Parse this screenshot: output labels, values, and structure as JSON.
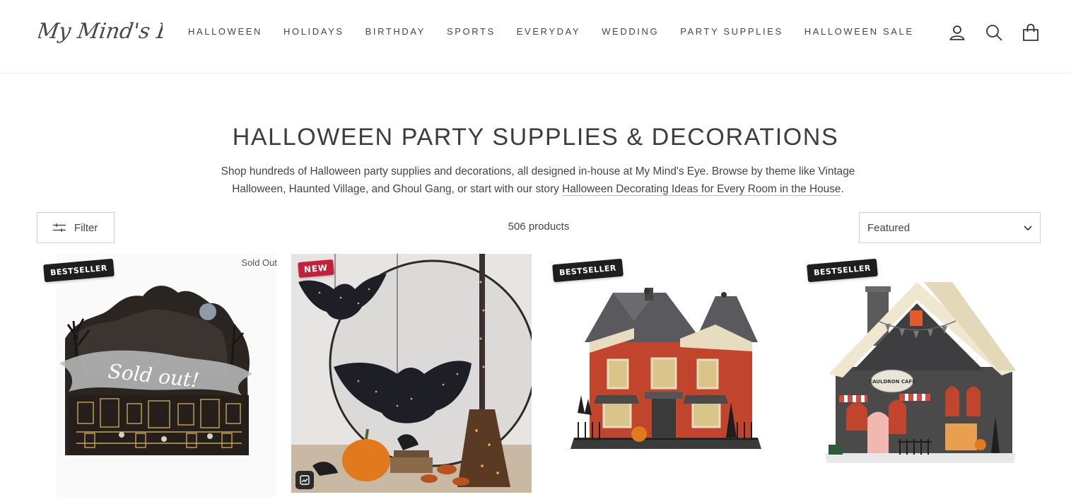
{
  "brand": {
    "logo_text": "My Mind's Eye"
  },
  "nav": {
    "items": [
      {
        "label": "HALLOWEEN"
      },
      {
        "label": "HOLIDAYS"
      },
      {
        "label": "BIRTHDAY"
      },
      {
        "label": "SPORTS"
      },
      {
        "label": "EVERYDAY"
      },
      {
        "label": "WEDDING"
      },
      {
        "label": "PARTY SUPPLIES"
      },
      {
        "label": "HALLOWEEN SALE"
      }
    ]
  },
  "header_icons": [
    "account-icon",
    "search-icon",
    "cart-icon"
  ],
  "collection": {
    "title": "HALLOWEEN PARTY SUPPLIES & DECORATIONS",
    "description": "Shop hundreds of Halloween party supplies and decorations, all designed in-house at My Mind's Eye. Browse by theme like Vintage Halloween, Haunted Village, and Ghoul Gang, or start with our story ",
    "description_link": "Halloween Decorating Ideas for Every Room in the House",
    "description_end": "."
  },
  "toolbar": {
    "filter_label": "Filter",
    "product_count": "506 products",
    "sort_value": "Featured"
  },
  "products": [
    {
      "badge": "BESTSELLER",
      "status": "Sold Out",
      "overlay_text": "Sold out!"
    },
    {
      "badge": "NEW"
    },
    {
      "badge": "BESTSELLER"
    },
    {
      "badge": "BESTSELLER",
      "sign_text": "CAULDRON CAFE"
    }
  ],
  "colors": {
    "accent_new": "#c41f3b",
    "badge_dark": "#1e1e1e",
    "text": "#444444"
  }
}
